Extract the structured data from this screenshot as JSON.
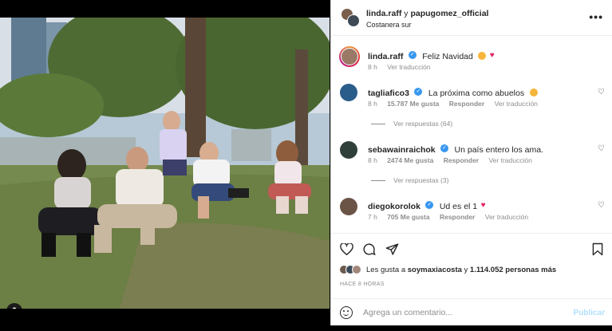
{
  "header": {
    "user1": "linda.raff",
    "connector": " y ",
    "user2": "papugomez_official",
    "location": "Costanera sur",
    "more_icon": "more-dots-icon"
  },
  "caption": {
    "user": "linda.raff",
    "text": "Feliz Navidad",
    "time": "8 h",
    "translate": "Ver traducción"
  },
  "comments": [
    {
      "user": "tagliafico3",
      "verified": true,
      "text": "La próxima como abuelos",
      "time": "8 h",
      "likes": "15.787 Me gusta",
      "reply": "Responder",
      "translate": "Ver traducción",
      "replies": "Ver respuestas (64)",
      "avatar_color": "#2b5d8a"
    },
    {
      "user": "sebawainraichok",
      "verified": true,
      "text": "Un país entero los ama.",
      "time": "8 h",
      "likes": "2474 Me gusta",
      "reply": "Responder",
      "translate": "Ver traducción",
      "replies": "Ver respuestas (3)",
      "avatar_color": "#2f3f3a"
    },
    {
      "user": "diegokorolok",
      "verified": true,
      "text": "Ud es el 1",
      "time": "7 h",
      "likes": "705 Me gusta",
      "reply": "Responder",
      "translate": "Ver traducción",
      "avatar_color": "#6b5346"
    }
  ],
  "actions": {
    "like_icon": "heart-icon",
    "comment_icon": "comment-icon",
    "share_icon": "send-icon",
    "save_icon": "bookmark-icon"
  },
  "likes": {
    "prefix": "Les gusta a ",
    "user": "soymaxiacosta",
    "middle": " y ",
    "count": "1.114.052 personas más"
  },
  "time_ago": "HACE 8 HORAS",
  "comment_box": {
    "placeholder": "Agrega un comentario...",
    "publish": "Publicar"
  },
  "colors": {
    "link_blue": "#b2dffc",
    "verified": "#3897f0",
    "heart": "#e0245e",
    "muted_text": "#8e8e8e"
  }
}
